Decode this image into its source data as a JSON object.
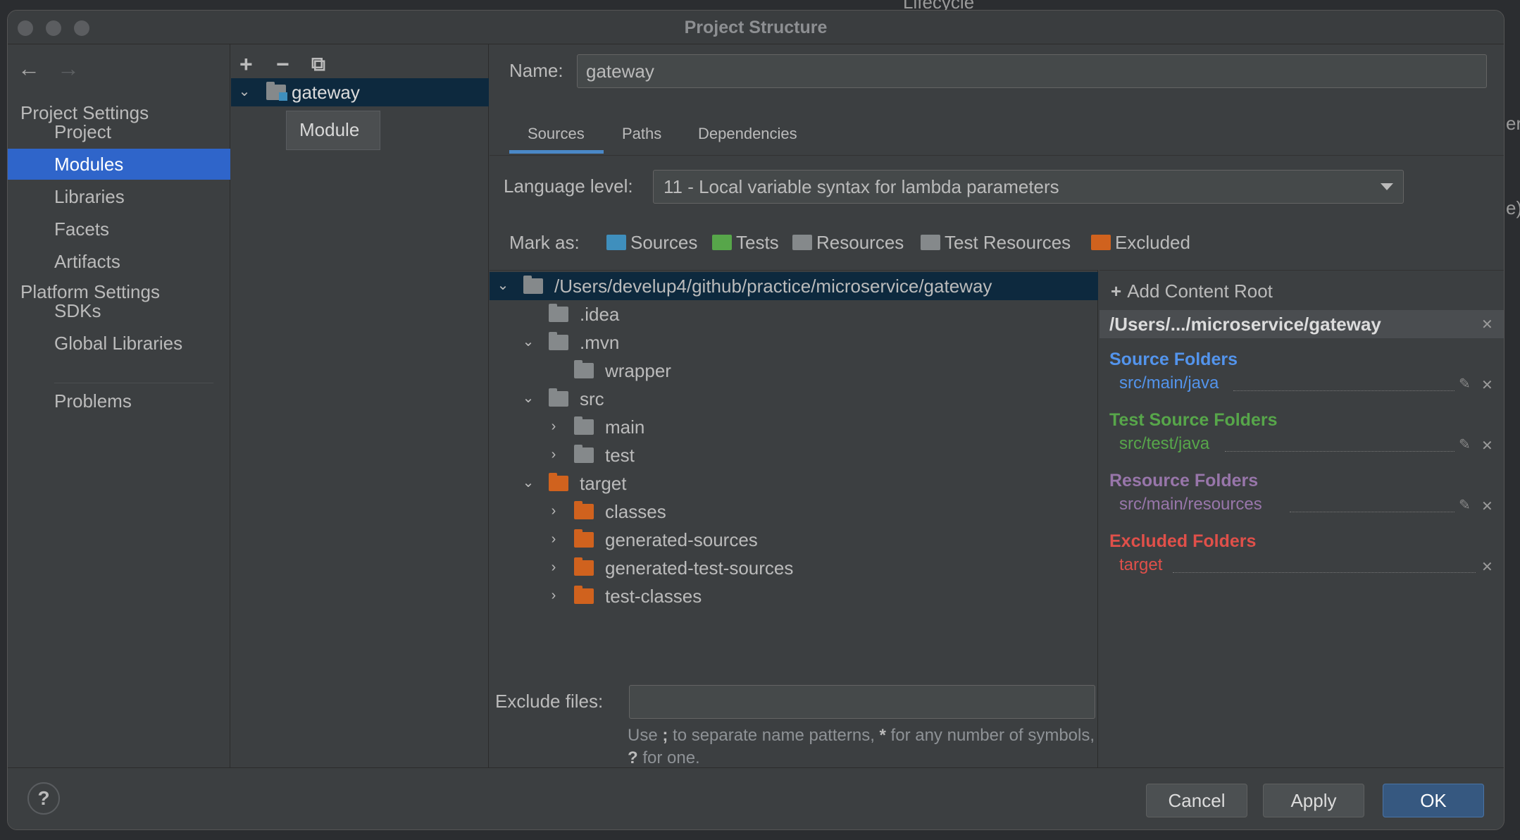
{
  "window": {
    "title": "Project Structure"
  },
  "background": {
    "frag1": "Lifecycle",
    "frag2": "er",
    "frag3": "e)"
  },
  "sidebar": {
    "back": "←",
    "forward": "→",
    "project_settings": "Project Settings",
    "items_a": [
      "Project",
      "Modules",
      "Libraries",
      "Facets",
      "Artifacts"
    ],
    "platform_settings": "Platform Settings",
    "items_b": [
      "SDKs",
      "Global Libraries"
    ],
    "problems": "Problems",
    "selected": "Modules"
  },
  "modules": {
    "add": "+",
    "remove": "−",
    "copy": "⧉",
    "module_name": "gateway",
    "tooltip": "Module"
  },
  "detail": {
    "name_label": "Name:",
    "name_value": "gateway",
    "tabs": [
      "Sources",
      "Paths",
      "Dependencies"
    ],
    "active_tab": "Sources",
    "language_label": "Language level:",
    "language_value": "11 - Local variable syntax for lambda parameters",
    "mark_as_label": "Mark as:",
    "mark_as": [
      "Sources",
      "Tests",
      "Resources",
      "Test Resources",
      "Excluded"
    ],
    "tree": [
      {
        "label": "/Users/develup4/github/practice/microservice/gateway",
        "expanded": true,
        "type": "module"
      },
      {
        "label": ".idea",
        "type": "folder"
      },
      {
        "label": ".mvn",
        "expanded": true,
        "type": "folder"
      },
      {
        "label": "wrapper",
        "type": "folder"
      },
      {
        "label": "src",
        "expanded": true,
        "type": "folder"
      },
      {
        "label": "main",
        "expanded": false,
        "type": "folder"
      },
      {
        "label": "test",
        "expanded": false,
        "type": "folder"
      },
      {
        "label": "target",
        "expanded": true,
        "type": "excluded"
      },
      {
        "label": "classes",
        "expanded": false,
        "type": "excluded"
      },
      {
        "label": "generated-sources",
        "expanded": false,
        "type": "excluded"
      },
      {
        "label": "generated-test-sources",
        "expanded": false,
        "type": "excluded"
      },
      {
        "label": "test-classes",
        "expanded": false,
        "type": "excluded"
      }
    ],
    "exclude_label": "Exclude files:",
    "exclude_value": "",
    "hint_1": "Use ",
    "hint_semi": ";",
    "hint_2": " to separate name patterns, ",
    "hint_star": "*",
    "hint_3": " for any number of symbols, ",
    "hint_q": "?",
    "hint_4": " for one."
  },
  "roots": {
    "add_content_root": "Add Content Root",
    "root_path": "/Users/.../microservice/gateway",
    "groups": [
      {
        "title": "Source Folders",
        "path": "src/main/java",
        "color": "#5394ec"
      },
      {
        "title": "Test Source Folders",
        "path": "src/test/java",
        "color": "#57a64a"
      },
      {
        "title": "Resource Folders",
        "path": "src/main/resources",
        "color": "#9876aa"
      },
      {
        "title": "Excluded Folders",
        "path": "target",
        "color": "#e0504a"
      }
    ]
  },
  "footer": {
    "help": "?",
    "cancel": "Cancel",
    "apply": "Apply",
    "ok": "OK"
  },
  "colors": {
    "selection": "#2f65ca",
    "tree_selection": "#0d293e",
    "ok_button": "#365880",
    "excluded_folder": "#d0621e"
  }
}
